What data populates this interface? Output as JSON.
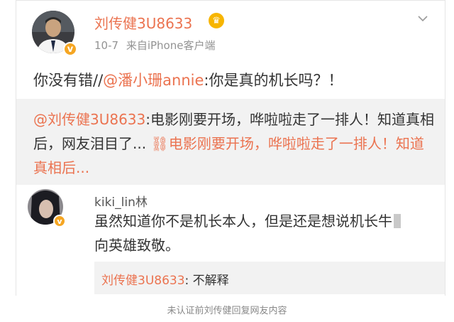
{
  "post": {
    "username": "刘传健3U8633",
    "time": "10-7",
    "source": "来自iPhone客户端",
    "text_prefix": "你没有错//",
    "text_mention": "@潘小珊annie",
    "text_suffix": ":你是真的机长吗？！"
  },
  "repost": {
    "mention": "@刘传健3U8633",
    "text": ":电影刚要开场，哗啦啦走了一排人！知道真相后，网友泪目了... ",
    "link_text": "电影刚要开场，哗啦啦走了一排人！知道真相后..."
  },
  "comment": {
    "username": "kiki_lin林",
    "text_line1": "虽然知道你不是机长本人，但是还是想说机长牛",
    "text_line2": "向英雄致敬。",
    "reply_user": "刘传健3U8633",
    "reply_text": ": 不解释"
  },
  "caption": "未认证前刘传健回复网友内容",
  "colors": {
    "accent": "#eb7350",
    "badge": "#f5a623"
  }
}
